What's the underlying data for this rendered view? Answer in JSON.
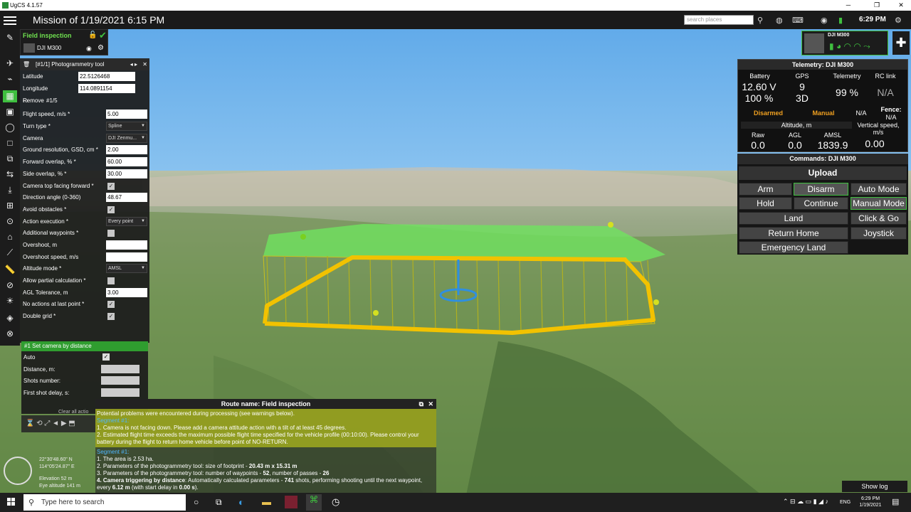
{
  "window": {
    "title": "UgCS 4.1.57",
    "min": "─",
    "restore": "❐",
    "close": "✕"
  },
  "topbar": {
    "mission_title": "Mission of 1/19/2021 6:15 PM",
    "search_placeholder": "search places",
    "time": "6:29 PM"
  },
  "mission": {
    "name": "Field inspection",
    "vehicle": "DJI M300"
  },
  "vehicle_panel": {
    "name": "DJI M300"
  },
  "photogrammetry": {
    "header": "[#1/1] Photogrammetry tool",
    "latitude_label": "Latitude",
    "latitude": "22.5126468",
    "longitude_label": "Longitude",
    "longitude": "114.0891154",
    "waypoint": "#1/5",
    "remove": "Remove",
    "params": [
      {
        "label": "Flight speed, m/s *",
        "type": "input",
        "value": "5.00"
      },
      {
        "label": "Turn type *",
        "type": "select",
        "value": "Spline"
      },
      {
        "label": "Camera",
        "type": "select",
        "value": "DJI Zenmu..."
      },
      {
        "label": "Ground resolution, GSD, cm *",
        "type": "input",
        "value": "2.00"
      },
      {
        "label": "Forward overlap, % *",
        "type": "input",
        "value": "60.00"
      },
      {
        "label": "Side overlap, % *",
        "type": "input",
        "value": "30.00"
      },
      {
        "label": "Camera top facing forward *",
        "type": "check",
        "value": "✓"
      },
      {
        "label": "Direction angle (0-360)",
        "type": "input",
        "value": "48.67"
      },
      {
        "label": "Avoid obstacles *",
        "type": "check",
        "value": "✓"
      },
      {
        "label": "Action execution *",
        "type": "select",
        "value": "Every point"
      },
      {
        "label": "Additional waypoints *",
        "type": "check",
        "value": ""
      },
      {
        "label": "Overshoot, m",
        "type": "input",
        "value": ""
      },
      {
        "label": "Overshoot speed, m/s",
        "type": "input",
        "value": ""
      },
      {
        "label": "Altitude mode *",
        "type": "select",
        "value": "AMSL"
      },
      {
        "label": "Allow partial calculation *",
        "type": "check",
        "value": ""
      },
      {
        "label": "AGL Tolerance, m",
        "type": "input",
        "value": "3.00"
      },
      {
        "label": "No actions at last point *",
        "type": "check",
        "value": "✓"
      },
      {
        "label": "Double grid *",
        "type": "check",
        "value": "✓"
      }
    ]
  },
  "camera_action": {
    "header": "#1 Set camera by distance",
    "auto": "Auto",
    "auto_check": "✓",
    "distance": "Distance, m:",
    "shots": "Shots number:",
    "first_shot": "First shot delay, s:",
    "clear": "Clear all actio"
  },
  "route": {
    "header": "Route name: Field inspection",
    "warning_intro": "Potential problems were encountered during processing (see warnings below).",
    "seg1": "Segment #1:",
    "w1": "1. Camera is not facing down. Please add a camera attitude action with a tilt of at least 45 degrees.",
    "w2": "2. Estimated flight time exceeds the maximum possible flight time specified for the vehicle profile (00:10:00). Please control your battery during the flight to return home vehicle before point of NO-RETURN.",
    "seg2": "Segment #1:",
    "i1": "1. The area is 2.53 ha.",
    "i2a": "2. Parameters of the photogrammetry tool: size of footprint - ",
    "i2b": "20.43 m x 15.31 m",
    "i3a": "3. Parameters of the photogrammetry tool: number of waypoints - ",
    "i3b": "52",
    "i3c": ", number of passes - ",
    "i3d": "26",
    "i4a": "4. Camera triggering by distance",
    "i4b": ": Automatically calculated parameters - ",
    "i4c": "741",
    "i4d": " shots, performing shooting until the next waypoint, every ",
    "i4e": "6.12 m",
    "i4f": " (with start delay in ",
    "i4g": "0.00 s",
    "i4h": ")."
  },
  "map_info": {
    "lat": "22°30'48.60\" N",
    "lon": "114°05'24.87\" E",
    "elevation": "Elevation 52 m",
    "eye": "Eye altitude 141 m"
  },
  "telemetry": {
    "header": "Telemetry: DJI M300",
    "battery_label": "Battery",
    "battery_v": "12.60 V",
    "battery_pct": "100 %",
    "gps_label": "GPS",
    "gps_sats": "9",
    "gps_fix": "3D",
    "telem_label": "Telemetry",
    "telem_val": "99 %",
    "rc_label": "RC link",
    "rc_val": "N/A",
    "armed": "Disarmed",
    "mode": "Manual",
    "na": "N/A",
    "fence": "Fence:",
    "fence_val": "N/A",
    "alt_label": "Altitude, m",
    "raw_label": "Raw",
    "raw": "0.0",
    "agl_label": "AGL",
    "agl": "0.0",
    "amsl_label": "AMSL",
    "amsl": "1839.9",
    "vs_label": "Vertical speed,",
    "vs_unit": "m/s",
    "vs": "0.00"
  },
  "commands": {
    "header": "Commands: DJI M300",
    "upload": "Upload",
    "arm": "Arm",
    "disarm": "Disarm",
    "auto": "Auto Mode",
    "hold": "Hold",
    "cont": "Continue",
    "manual": "Manual Mode",
    "land": "Land",
    "clickgo": "Click & Go",
    "rth": "Return Home",
    "joystick": "Joystick",
    "eland": "Emergency Land"
  },
  "show_log": "Show log",
  "taskbar": {
    "search": "Type here to search",
    "lang": "ENG",
    "time": "6:29 PM",
    "date": "1/19/2021"
  },
  "colors": {
    "accent": "#3fbf3f",
    "route": "#f2c200",
    "grid": "#6fe35f",
    "warning": "#a0aa1e"
  }
}
